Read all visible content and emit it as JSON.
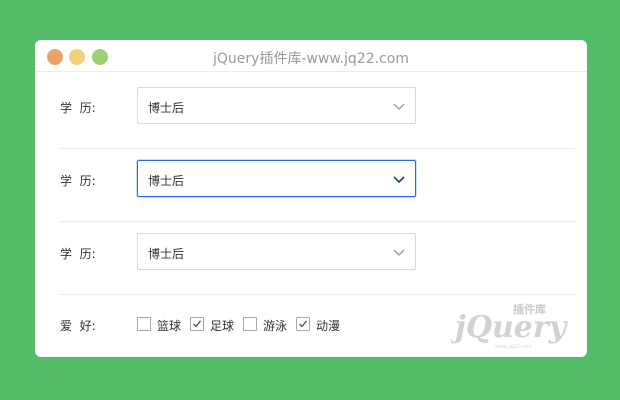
{
  "window": {
    "title": "jQuery插件库-www.jq22.com",
    "colors": {
      "close": "#e8a36a",
      "minimize": "#f3d07a",
      "maximize": "#9ed07a"
    }
  },
  "form": {
    "education_label": "学  历:",
    "selects": [
      {
        "value": "博士后",
        "focused": false
      },
      {
        "value": "博士后",
        "focused": true
      },
      {
        "value": "博士后",
        "focused": false
      }
    ],
    "hobby_label": "爱  好:",
    "hobbies": [
      {
        "label": "篮球",
        "checked": false
      },
      {
        "label": "足球",
        "checked": true
      },
      {
        "label": "游泳",
        "checked": false
      },
      {
        "label": "动漫",
        "checked": true
      }
    ]
  },
  "watermark": {
    "top_text": "插件库",
    "main_text": "jQuery",
    "small_text": "www.jq22.com"
  },
  "icons": {
    "dropdown": "chevron-down-icon",
    "check": "check-icon"
  },
  "accent": "#2f6bd6",
  "background": "#52bc68"
}
